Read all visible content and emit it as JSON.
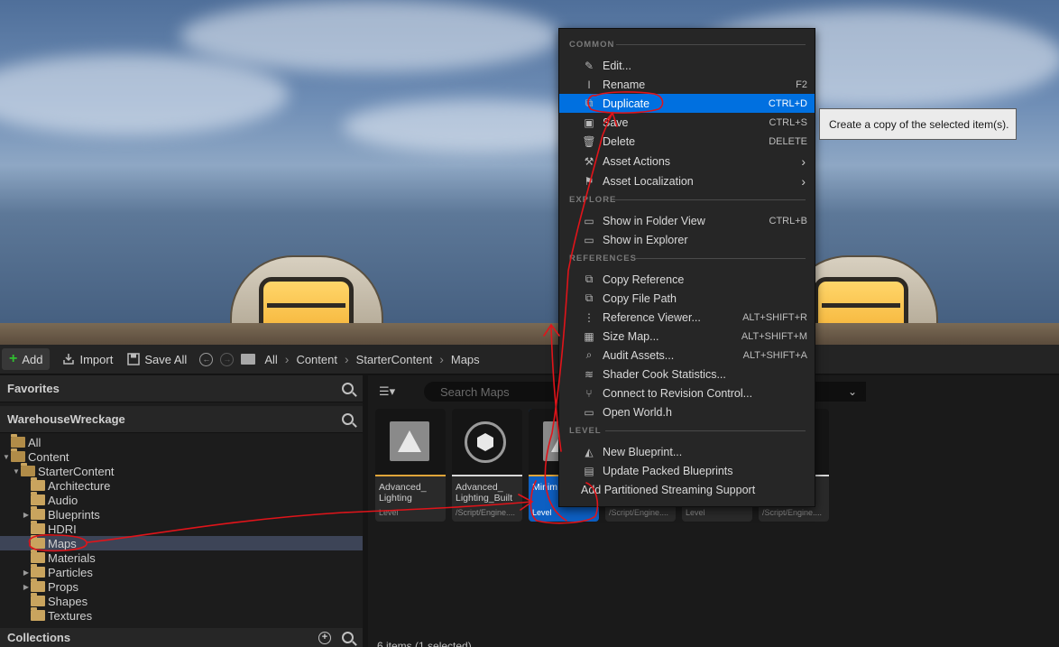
{
  "toolbar": {
    "add_label": "Add",
    "import_label": "Import",
    "save_all_label": "Save All",
    "breadcrumb": [
      "All",
      "Content",
      "StarterContent",
      "Maps"
    ]
  },
  "left_panel": {
    "favorites_title": "Favorites",
    "project_title": "WarehouseWreckage",
    "tree": [
      {
        "label": "All",
        "depth": 0,
        "expander": "",
        "selected": false,
        "open": true
      },
      {
        "label": "Content",
        "depth": 0,
        "expander": "down",
        "selected": false,
        "open": true
      },
      {
        "label": "StarterContent",
        "depth": 1,
        "expander": "down",
        "selected": false,
        "open": true
      },
      {
        "label": "Architecture",
        "depth": 2,
        "expander": "",
        "selected": false,
        "open": false
      },
      {
        "label": "Audio",
        "depth": 2,
        "expander": "",
        "selected": false,
        "open": false
      },
      {
        "label": "Blueprints",
        "depth": 2,
        "expander": "right",
        "selected": false,
        "open": false
      },
      {
        "label": "HDRI",
        "depth": 2,
        "expander": "",
        "selected": false,
        "open": false
      },
      {
        "label": "Maps",
        "depth": 2,
        "expander": "",
        "selected": true,
        "open": false
      },
      {
        "label": "Materials",
        "depth": 2,
        "expander": "",
        "selected": false,
        "open": false
      },
      {
        "label": "Particles",
        "depth": 2,
        "expander": "right",
        "selected": false,
        "open": false
      },
      {
        "label": "Props",
        "depth": 2,
        "expander": "right",
        "selected": false,
        "open": false
      },
      {
        "label": "Shapes",
        "depth": 2,
        "expander": "",
        "selected": false,
        "open": false
      },
      {
        "label": "Textures",
        "depth": 2,
        "expander": "",
        "selected": false,
        "open": false
      }
    ],
    "collections_title": "Collections"
  },
  "content": {
    "search_placeholder": "Search Maps",
    "status": "6 items (1 selected)",
    "tiles": [
      {
        "name": "Advanced_ Lighting",
        "type": "Level",
        "icon": "level-icon",
        "bar_color": "#e0a53a",
        "selected": false
      },
      {
        "name": "Advanced_ Lighting_Built",
        "type": "/Script/Engine....",
        "icon": "cube-icon",
        "bar_color": "#d8d8d8",
        "selected": false
      },
      {
        "name": "Minim Defau",
        "type": "Level",
        "icon": "level-icon",
        "bar_color": "#e0a53a",
        "selected": true
      },
      {
        "name": "",
        "type": "/Script/Engine....",
        "icon": "",
        "bar_color": "#d8d8d8",
        "selected": false
      },
      {
        "name": "",
        "type": "Level",
        "icon": "",
        "bar_color": "#e0a53a",
        "selected": false
      },
      {
        "name": "",
        "type": "/Script/Engine....",
        "icon": "",
        "bar_color": "#d8d8d8",
        "selected": false
      }
    ]
  },
  "context_menu": {
    "sections": [
      {
        "title": "COMMON",
        "items": [
          {
            "label": "Edit...",
            "shortcut": "",
            "icon": "pencil-icon",
            "submenu": false,
            "highlight": false
          },
          {
            "label": "Rename",
            "shortcut": "F2",
            "icon": "rename-icon",
            "submenu": false,
            "highlight": false
          },
          {
            "label": "Duplicate",
            "shortcut": "CTRL+D",
            "icon": "duplicate-icon",
            "submenu": false,
            "highlight": true
          },
          {
            "label": "Save",
            "shortcut": "CTRL+S",
            "icon": "save-icon",
            "submenu": false,
            "highlight": false
          },
          {
            "label": "Delete",
            "shortcut": "DELETE",
            "icon": "trash-icon",
            "submenu": false,
            "highlight": false
          },
          {
            "label": "Asset Actions",
            "shortcut": "",
            "icon": "wrench-icon",
            "submenu": true,
            "highlight": false
          },
          {
            "label": "Asset Localization",
            "shortcut": "",
            "icon": "flag-icon",
            "submenu": true,
            "highlight": false
          }
        ]
      },
      {
        "title": "EXPLORE",
        "items": [
          {
            "label": "Show in Folder View",
            "shortcut": "CTRL+B",
            "icon": "folder-search-icon",
            "submenu": false,
            "highlight": false
          },
          {
            "label": "Show in Explorer",
            "shortcut": "",
            "icon": "folder-search-icon",
            "submenu": false,
            "highlight": false
          }
        ]
      },
      {
        "title": "REFERENCES",
        "items": [
          {
            "label": "Copy Reference",
            "shortcut": "",
            "icon": "copy-icon",
            "submenu": false,
            "highlight": false
          },
          {
            "label": "Copy File Path",
            "shortcut": "",
            "icon": "copy-icon",
            "submenu": false,
            "highlight": false
          },
          {
            "label": "Reference Viewer...",
            "shortcut": "ALT+SHIFT+R",
            "icon": "graph-icon",
            "submenu": false,
            "highlight": false
          },
          {
            "label": "Size Map...",
            "shortcut": "ALT+SHIFT+M",
            "icon": "sizemap-icon",
            "submenu": false,
            "highlight": false
          },
          {
            "label": "Audit Assets...",
            "shortcut": "ALT+SHIFT+A",
            "icon": "audit-icon",
            "submenu": false,
            "highlight": false
          },
          {
            "label": "Shader Cook Statistics...",
            "shortcut": "",
            "icon": "shader-icon",
            "submenu": false,
            "highlight": false
          },
          {
            "label": "Connect to Revision Control...",
            "shortcut": "",
            "icon": "branch-icon",
            "submenu": false,
            "highlight": false
          },
          {
            "label": "Open World.h",
            "shortcut": "",
            "icon": "code-icon",
            "submenu": false,
            "highlight": false
          }
        ]
      },
      {
        "title": "LEVEL",
        "items": [
          {
            "label": "New Blueprint...",
            "shortcut": "",
            "icon": "blueprint-icon",
            "submenu": false,
            "highlight": false
          },
          {
            "label": "Update Packed Blueprints",
            "shortcut": "",
            "icon": "package-icon",
            "submenu": false,
            "highlight": false
          },
          {
            "label": "Add Partitioned Streaming Support",
            "shortcut": "",
            "icon": "",
            "submenu": false,
            "highlight": false
          }
        ]
      }
    ]
  },
  "tooltip": "Create a copy of the selected item(s).",
  "annotation_color": "#e0141a"
}
